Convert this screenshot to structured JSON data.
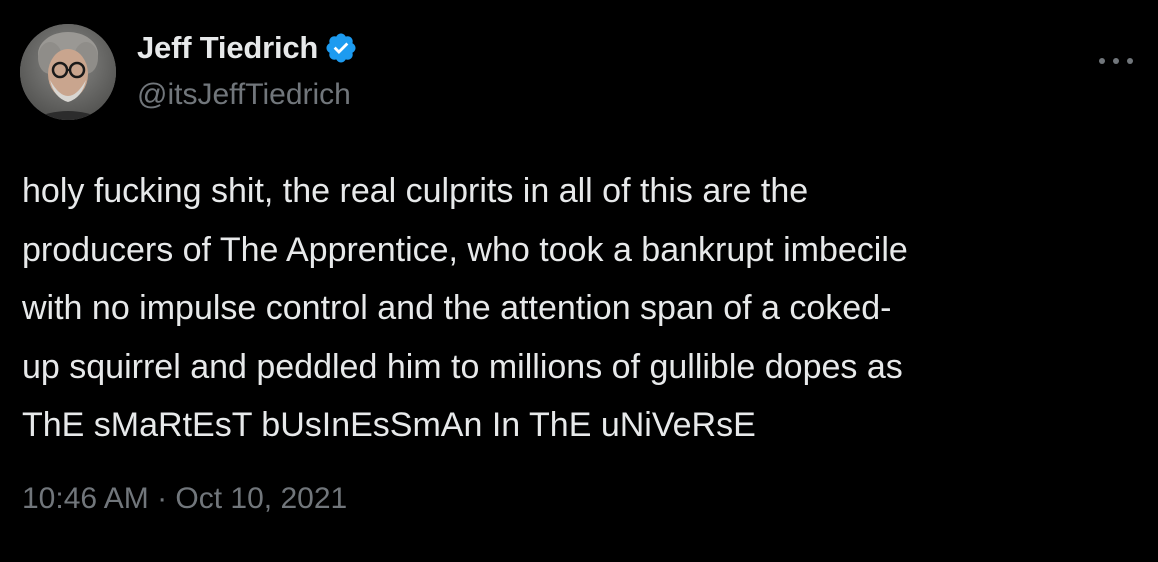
{
  "author": {
    "display_name": "Jeff Tiedrich",
    "handle": "@itsJeffTiedrich",
    "verified": true,
    "avatar": "profile-photo-man-glasses-beard"
  },
  "tweet": {
    "lines": [
      "holy fucking shit, the real culprits in all of this are the",
      "producers of The Apprentice, who took a bankrupt imbecile",
      "with no impulse control and the attention span of a coked-",
      "up squirrel and peddled him to millions of gullible dopes as",
      "ThE sMaRtEsT bUsInEsSmAn In ThE uNiVeRsE"
    ],
    "timestamp": "10:46 AM · Oct 10, 2021"
  },
  "icons": {
    "verified_badge": "verified-badge-icon",
    "more": "more-options-icon"
  },
  "colors": {
    "background": "#000000",
    "primary_text": "#e7e9ea",
    "secondary_text": "#71767b",
    "verified_blue": "#1d9bf0"
  }
}
